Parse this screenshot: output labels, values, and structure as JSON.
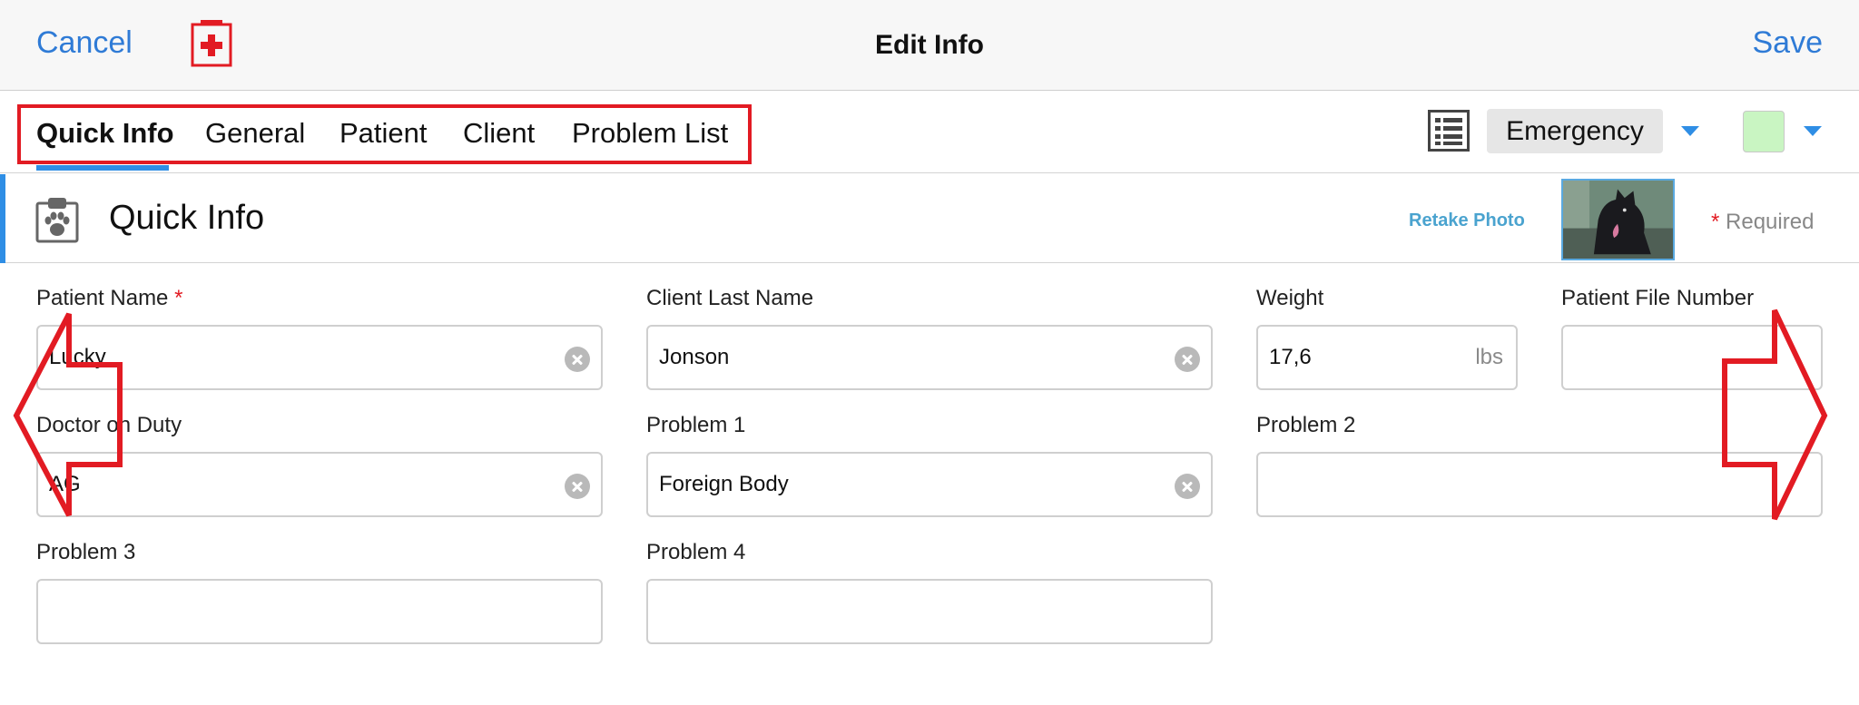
{
  "navbar": {
    "cancel_label": "Cancel",
    "title": "Edit Info",
    "save_label": "Save",
    "kit_icon": "medical-kit-icon"
  },
  "tabs": [
    {
      "label": "Quick Info",
      "active": true
    },
    {
      "label": "General",
      "active": false
    },
    {
      "label": "Patient",
      "active": false
    },
    {
      "label": "Client",
      "active": false
    },
    {
      "label": "Problem List",
      "active": false
    }
  ],
  "toolbar": {
    "list_icon": "list-icon",
    "triage_value": "Emergency",
    "color_value": "#c9f5c2"
  },
  "section": {
    "icon": "clipboard-paw-icon",
    "title": "Quick Info",
    "retake_label": "Retake Photo",
    "required_star": "*",
    "required_label": "Required"
  },
  "form": {
    "patient_name": {
      "label": "Patient Name",
      "required_star": "*",
      "value": "Lucky"
    },
    "client_last_name": {
      "label": "Client Last Name",
      "value": "Jonson"
    },
    "weight": {
      "label": "Weight",
      "value": "17,6",
      "unit": "lbs"
    },
    "patient_file_number": {
      "label": "Patient File Number",
      "value": ""
    },
    "doctor_on_duty": {
      "label": "Doctor on Duty",
      "value": "AG"
    },
    "problem_1": {
      "label": "Problem 1",
      "value": "Foreign Body"
    },
    "problem_2": {
      "label": "Problem 2",
      "value": ""
    },
    "problem_3": {
      "label": "Problem 3",
      "value": ""
    },
    "problem_4": {
      "label": "Problem 4",
      "value": ""
    }
  },
  "colors": {
    "accent": "#2f8ee5",
    "link": "#2f7bd6",
    "annotation": "#e21b23"
  }
}
